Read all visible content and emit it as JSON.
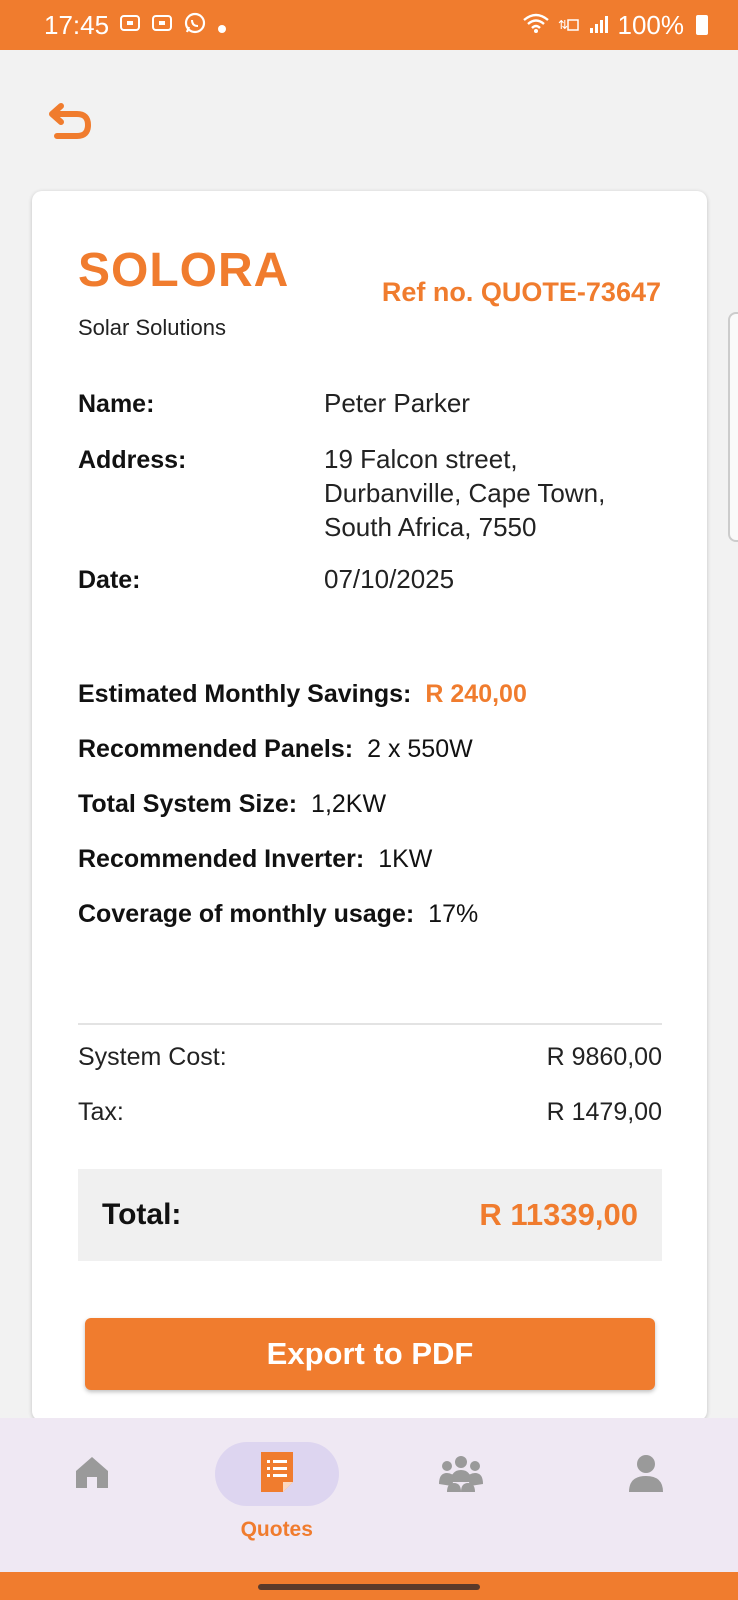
{
  "status_bar": {
    "time": "17:45",
    "notification_icons": [
      "screenshot-icon",
      "screenshot-icon",
      "whatsapp-icon",
      "dot-icon"
    ],
    "battery": "100%"
  },
  "header": {
    "back_icon": "undo-arrow-icon"
  },
  "quote": {
    "brand": "SOLORA",
    "brand_sub": "Solar Solutions",
    "ref": "Ref no. QUOTE-73647",
    "name_label": "Name:",
    "name_value": "Peter Parker",
    "address_label": "Address:",
    "address_lines": [
      "19 Falcon street,",
      "Durbanville, Cape Town,",
      "South Africa, 7550"
    ],
    "date_label": "Date:",
    "date_value": "07/10/2025",
    "stats": [
      {
        "label": "Estimated Monthly Savings:",
        "value": "R 240,00"
      },
      {
        "label": "Recommended Panels:",
        "value": "2 x 550W"
      },
      {
        "label": "Total System Size:",
        "value": "1,2KW"
      },
      {
        "label": "Recommended Inverter:",
        "value": "1KW"
      },
      {
        "label": "Coverage of monthly usage:",
        "value": "17%"
      }
    ],
    "costs": [
      {
        "label": "System Cost:",
        "value": "R 9860,00"
      },
      {
        "label": "Tax:",
        "value": "R 1479,00"
      }
    ],
    "total_label": "Total:",
    "total_value": "R 11339,00",
    "export_label": "Export to PDF"
  },
  "nav": {
    "items": [
      {
        "icon": "home-icon",
        "label": ""
      },
      {
        "icon": "quotes-icon",
        "label": "Quotes"
      },
      {
        "icon": "group-icon",
        "label": ""
      },
      {
        "icon": "profile-icon",
        "label": ""
      }
    ],
    "active_index": 1
  },
  "colors": {
    "accent": "#f07c2e",
    "nav_bg": "#efe8f3",
    "nav_active_pill": "#ddd5f0"
  }
}
